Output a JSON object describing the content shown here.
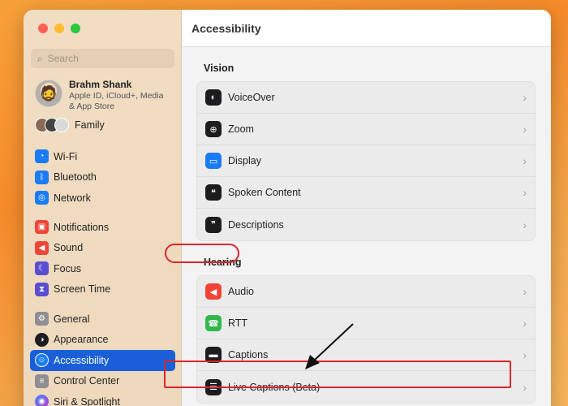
{
  "sidebar": {
    "search_placeholder": "Search",
    "profile": {
      "name": "Brahm Shank",
      "subtitle": "Apple ID, iCloud+, Media & App Store"
    },
    "family_label": "Family",
    "group1": [
      {
        "label": "Wi-Fi",
        "icon": "wifi-icon",
        "color": "#1a7cf5"
      },
      {
        "label": "Bluetooth",
        "icon": "bluetooth-icon",
        "color": "#1a7cf5"
      },
      {
        "label": "Network",
        "icon": "globe-icon",
        "color": "#1a7cf5"
      }
    ],
    "group2": [
      {
        "label": "Notifications",
        "icon": "bell-icon",
        "color": "#f04438"
      },
      {
        "label": "Sound",
        "icon": "speaker-icon",
        "color": "#f04438"
      },
      {
        "label": "Focus",
        "icon": "moon-icon",
        "color": "#5b4fd1"
      },
      {
        "label": "Screen Time",
        "icon": "hourglass-icon",
        "color": "#5b4fd1"
      }
    ],
    "group3": [
      {
        "label": "General",
        "icon": "gear-icon",
        "color": "#8e8e93"
      },
      {
        "label": "Appearance",
        "icon": "appearance-icon",
        "color": "#1d1d1f"
      },
      {
        "label": "Accessibility",
        "icon": "accessibility-icon",
        "color": "#1a7cf5",
        "selected": true
      },
      {
        "label": "Control Center",
        "icon": "control-center-icon",
        "color": "#8e8e93"
      },
      {
        "label": "Siri & Spotlight",
        "icon": "siri-icon",
        "color": "#6d3fd1"
      }
    ]
  },
  "main": {
    "title": "Accessibility",
    "vision": {
      "title": "Vision",
      "items": [
        {
          "label": "VoiceOver",
          "icon": "voiceover-icon"
        },
        {
          "label": "Zoom",
          "icon": "zoom-icon"
        },
        {
          "label": "Display",
          "icon": "display-icon"
        },
        {
          "label": "Spoken Content",
          "icon": "spoken-content-icon"
        },
        {
          "label": "Descriptions",
          "icon": "descriptions-icon"
        }
      ]
    },
    "hearing": {
      "title": "Hearing",
      "items": [
        {
          "label": "Audio",
          "icon": "audio-icon"
        },
        {
          "label": "RTT",
          "icon": "rtt-icon"
        },
        {
          "label": "Captions",
          "icon": "captions-icon"
        },
        {
          "label": "Live Captions (Beta)",
          "icon": "live-captions-icon"
        }
      ]
    }
  },
  "colors": {
    "accent": "#1a5fd8",
    "annotation": "#d8262f"
  }
}
